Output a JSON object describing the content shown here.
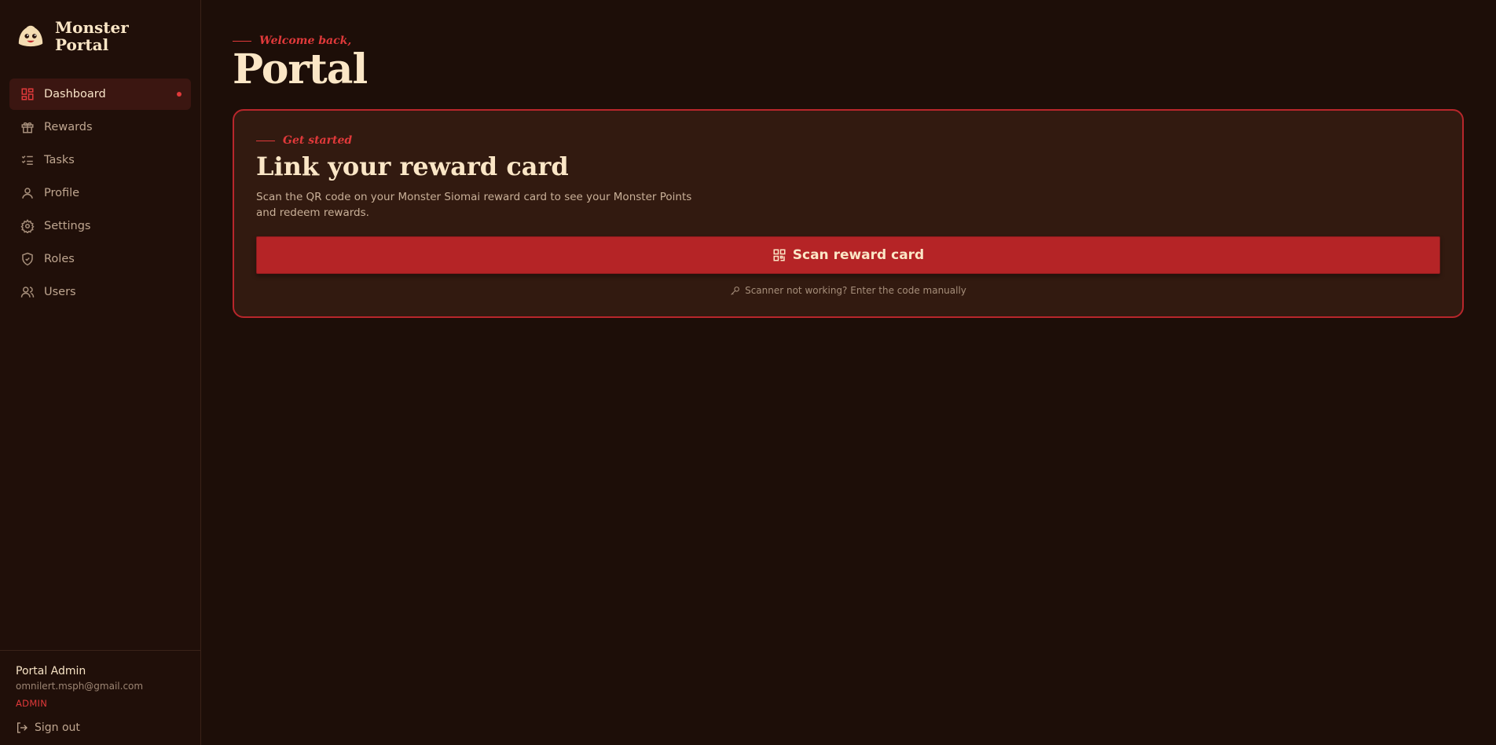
{
  "brand": {
    "name_line1": "Monster",
    "name_line2": "Portal",
    "logo_icon": "dumpling-monster-logo"
  },
  "sidebar": {
    "items": [
      {
        "label": "Dashboard",
        "icon": "grid-icon",
        "active": true
      },
      {
        "label": "Rewards",
        "icon": "gift-icon"
      },
      {
        "label": "Tasks",
        "icon": "checklist-icon"
      },
      {
        "label": "Profile",
        "icon": "user-icon"
      },
      {
        "label": "Settings",
        "icon": "gear-icon"
      },
      {
        "label": "Roles",
        "icon": "shield-icon"
      },
      {
        "label": "Users",
        "icon": "users-icon"
      }
    ]
  },
  "user": {
    "name": "Portal Admin",
    "email": "omnilert.msph@gmail.com",
    "role": "ADMIN",
    "signout_label": "Sign out"
  },
  "header": {
    "eyebrow": "Welcome back,",
    "title": "Portal"
  },
  "card": {
    "eyebrow": "Get started",
    "title": "Link your reward card",
    "description": "Scan the QR code on your Monster Siomai reward card to see your Monster Points and redeem rewards.",
    "scan_button_label": "Scan reward card",
    "manual_link": "Scanner not working? Enter the code manually"
  },
  "colors": {
    "accent": "#e0393a",
    "button": "#b52426",
    "background": "#1d0e08",
    "card": "#321a10",
    "text": "#fbe6c6"
  }
}
